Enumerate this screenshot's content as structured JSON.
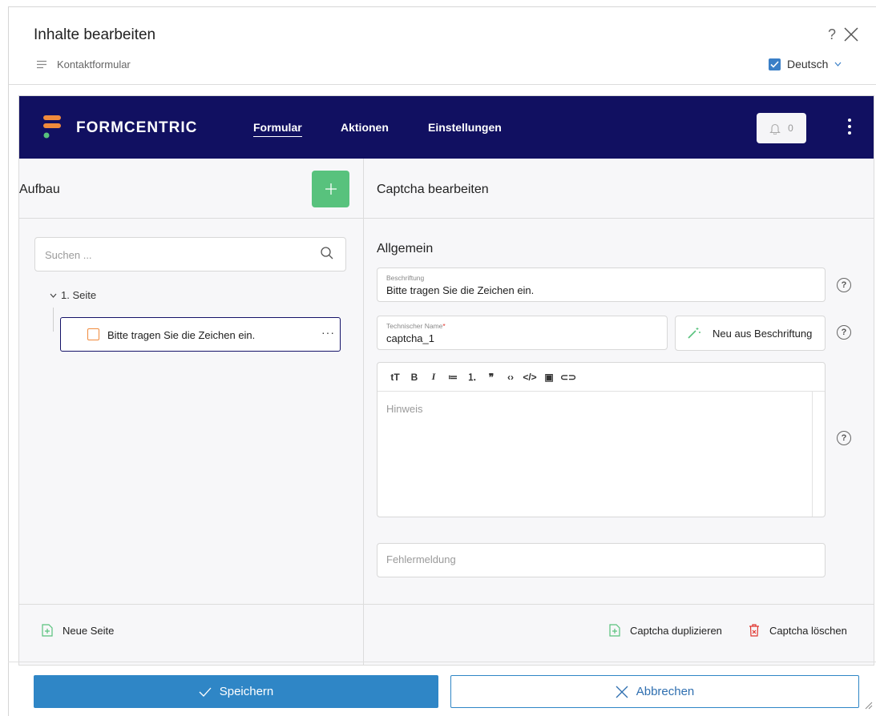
{
  "dialog": {
    "title": "Inhalte bearbeiten",
    "help": "?",
    "breadcrumb": "Kontaktformular",
    "language": "Deutsch"
  },
  "nav": {
    "brand": "FORMCENTRIC",
    "links": [
      "Formular",
      "Aktionen",
      "Einstellungen"
    ],
    "notifications": "0",
    "colors": {
      "bg": "#111061",
      "logo_orange": "#f08a3c",
      "logo_green": "#58c27d"
    }
  },
  "left": {
    "title": "Aufbau",
    "search_placeholder": "Suchen ...",
    "page_label": "1. Seite",
    "item_label": "Bitte tragen Sie die Zeichen ein.",
    "item_more": "···",
    "footer_action": "Neue Seite"
  },
  "right": {
    "title": "Captcha bearbeiten",
    "section": "Allgemein",
    "label_caption": "Beschriftung",
    "label_value": "Bitte tragen Sie die Zeichen ein.",
    "name_caption": "Technischer Name",
    "name_required": "*",
    "name_value": "captcha_1",
    "generate_button": "Neu aus Beschriftung",
    "hint_placeholder": "Hinweis",
    "error_placeholder": "Fehlermeldung",
    "help": "?",
    "duplicate": "Captcha duplizieren",
    "delete": "Captcha löschen"
  },
  "toolbar": [
    "tT",
    "B",
    "I",
    "≔",
    "⒈",
    "❞",
    "‹›",
    "</>",
    "▣",
    "⊂⊃"
  ],
  "footer": {
    "save": "Speichern",
    "cancel": "Abbrechen"
  }
}
